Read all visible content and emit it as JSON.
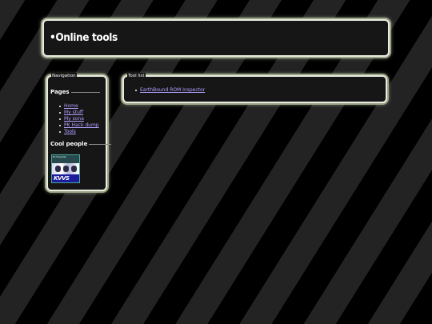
{
  "header": {
    "title": "•Online tools"
  },
  "navigation": {
    "legend": "Navigation",
    "pages_heading": "Pages",
    "pages": [
      {
        "label": "Home"
      },
      {
        "label": "My stuff"
      },
      {
        "label": "My sona"
      },
      {
        "label": "PK Hack dump"
      },
      {
        "label": "Tools"
      }
    ],
    "cool_people_heading": "Cool people",
    "cool_people_button": {
      "top_text": "Dr.Freeman",
      "logo_text": "KVVS"
    }
  },
  "tool_list": {
    "legend": "Tool list",
    "items": [
      {
        "label": "EarthBound ROM Inspector"
      }
    ]
  },
  "colors": {
    "link": "#b4a0ff",
    "panel_border": "#e9ece0",
    "panel_background": "#161616",
    "stripe_dark": "#000000",
    "stripe_light": "#232323"
  }
}
